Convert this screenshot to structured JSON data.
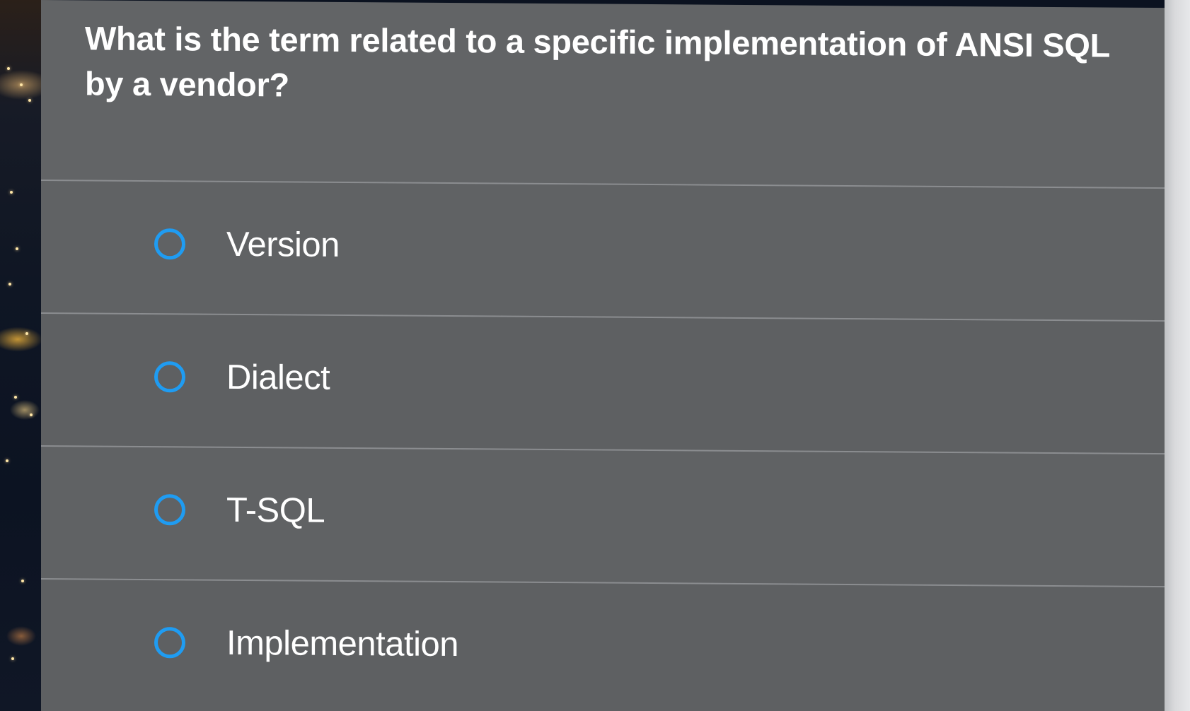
{
  "quiz": {
    "question": "What is the term related to a specific implementation of ANSI SQL by a vendor?",
    "options": [
      {
        "label": "Version",
        "selected": false
      },
      {
        "label": "Dialect",
        "selected": false
      },
      {
        "label": "T-SQL",
        "selected": false
      },
      {
        "label": "Implementation",
        "selected": false
      }
    ]
  },
  "colors": {
    "panel": "#626466",
    "radio_border": "#1f9cf2",
    "text": "#ffffff"
  }
}
